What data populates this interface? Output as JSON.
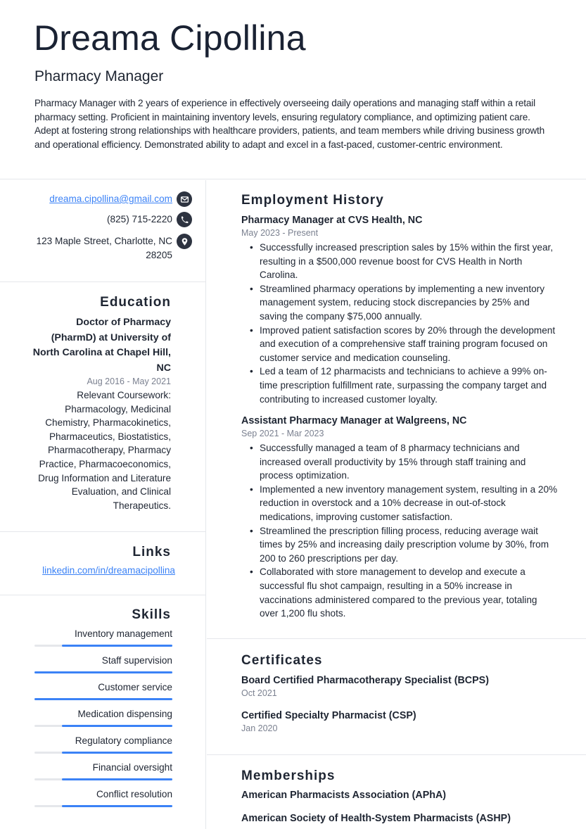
{
  "header": {
    "name": "Dreama Cipollina",
    "job_title": "Pharmacy Manager",
    "summary": "Pharmacy Manager with 2 years of experience in effectively overseeing daily operations and managing staff within a retail pharmacy setting. Proficient in maintaining inventory levels, ensuring regulatory compliance, and optimizing patient care. Adept at fostering strong relationships with healthcare providers, patients, and team members while driving business growth and operational efficiency. Demonstrated ability to adapt and excel in a fast-paced, customer-centric environment."
  },
  "contact": {
    "email": "dreama.cipollina@gmail.com",
    "phone": "(825) 715-2220",
    "address": "123 Maple Street, Charlotte, NC 28205",
    "icons": [
      "envelope-icon",
      "phone-icon",
      "map-pin-icon"
    ]
  },
  "education": {
    "heading": "Education",
    "degree": "Doctor of Pharmacy (PharmD) at University of North Carolina at Chapel Hill, NC",
    "date": "Aug 2016 - May 2021",
    "description": "Relevant Coursework: Pharmacology, Medicinal Chemistry, Pharmacokinetics, Pharmaceutics, Biostatistics, Pharmacotherapy, Pharmacy Practice, Pharmacoeconomics, Drug Information and Literature Evaluation, and Clinical Therapeutics."
  },
  "links": {
    "heading": "Links",
    "items": [
      "linkedin.com/in/dreamacipollina"
    ]
  },
  "skills": {
    "heading": "Skills",
    "items": [
      {
        "name": "Inventory management",
        "level": 0.8
      },
      {
        "name": "Staff supervision",
        "level": 1.0
      },
      {
        "name": "Customer service",
        "level": 1.0
      },
      {
        "name": "Medication dispensing",
        "level": 0.8
      },
      {
        "name": "Regulatory compliance",
        "level": 0.8
      },
      {
        "name": "Financial oversight",
        "level": 0.8
      },
      {
        "name": "Conflict resolution",
        "level": 0.8
      }
    ]
  },
  "employment": {
    "heading": "Employment History",
    "jobs": [
      {
        "title": "Pharmacy Manager at CVS Health, NC",
        "date": "May 2023 - Present",
        "bullets": [
          "Successfully increased prescription sales by 15% within the first year, resulting in a $500,000 revenue boost for CVS Health in North Carolina.",
          "Streamlined pharmacy operations by implementing a new inventory management system, reducing stock discrepancies by 25% and saving the company $75,000 annually.",
          "Improved patient satisfaction scores by 20% through the development and execution of a comprehensive staff training program focused on customer service and medication counseling.",
          "Led a team of 12 pharmacists and technicians to achieve a 99% on-time prescription fulfillment rate, surpassing the company target and contributing to increased customer loyalty."
        ]
      },
      {
        "title": "Assistant Pharmacy Manager at Walgreens, NC",
        "date": "Sep 2021 - Mar 2023",
        "bullets": [
          "Successfully managed a team of 8 pharmacy technicians and increased overall productivity by 15% through staff training and process optimization.",
          "Implemented a new inventory management system, resulting in a 20% reduction in overstock and a 10% decrease in out-of-stock medications, improving customer satisfaction.",
          "Streamlined the prescription filling process, reducing average wait times by 25% and increasing daily prescription volume by 30%, from 200 to 260 prescriptions per day.",
          "Collaborated with store management to develop and execute a successful flu shot campaign, resulting in a 50% increase in vaccinations administered compared to the previous year, totaling over 1,200 flu shots."
        ]
      }
    ]
  },
  "certificates": {
    "heading": "Certificates",
    "items": [
      {
        "name": "Board Certified Pharmacotherapy Specialist (BCPS)",
        "date": "Oct 2021"
      },
      {
        "name": "Certified Specialty Pharmacist (CSP)",
        "date": "Jan 2020"
      }
    ]
  },
  "memberships": {
    "heading": "Memberships",
    "items": [
      "American Pharmacists Association (APhA)",
      "American Society of Health-System Pharmacists (ASHP)"
    ]
  },
  "colors": {
    "accent": "#3b82f6",
    "text": "#1e2532",
    "muted": "#7b8190",
    "icon_bg": "#2d3340",
    "divider": "#e5e7eb"
  }
}
